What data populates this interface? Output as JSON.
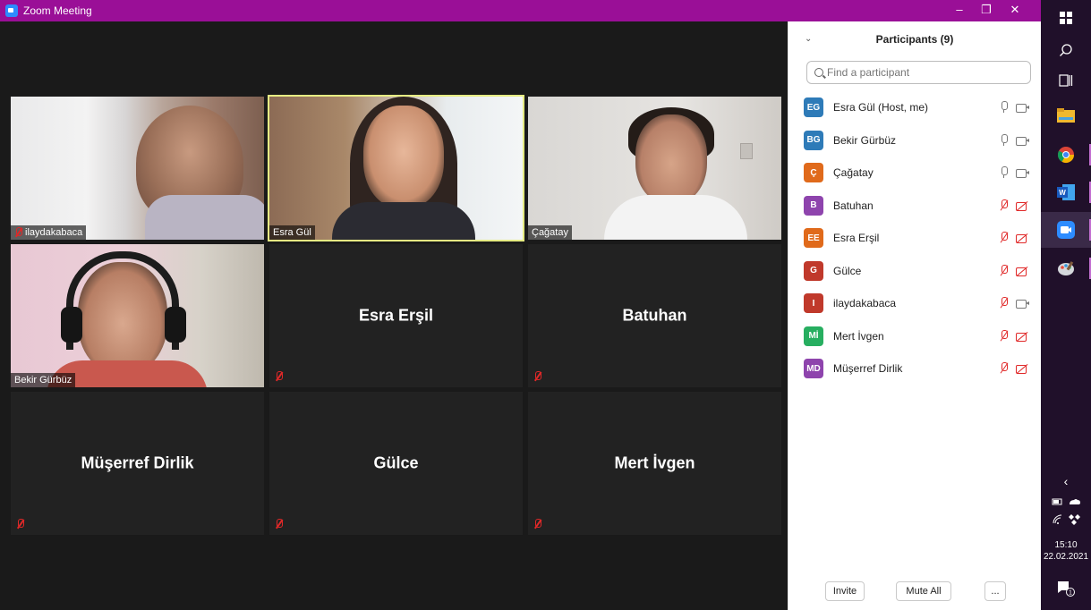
{
  "window": {
    "title": "Zoom Meeting",
    "minimize": "–",
    "restore": "❐",
    "close": "✕",
    "title_bar_color": "#9a0f97"
  },
  "video_tiles": [
    {
      "name": "ilaydakabaca",
      "video": true,
      "muted": true
    },
    {
      "name": "Esra Gül",
      "video": true,
      "muted": false,
      "active_speaker": true
    },
    {
      "name": "Çağatay",
      "video": true,
      "muted": false
    },
    {
      "name": "Bekir Gürbüz",
      "video": true,
      "muted": false
    },
    {
      "name": "Esra Erşil",
      "video": false,
      "muted": true
    },
    {
      "name": "Batuhan",
      "video": false,
      "muted": true
    },
    {
      "name": "Müşerref Dirlik",
      "video": false,
      "muted": true
    },
    {
      "name": "Gülce",
      "video": false,
      "muted": true
    },
    {
      "name": "Mert İvgen",
      "video": false,
      "muted": true
    }
  ],
  "participants_panel": {
    "title": "Participants (9)",
    "search_placeholder": "Find a participant",
    "participants": [
      {
        "initials": "EG",
        "name": "Esra Gül (Host, me)",
        "color": "#2e7bb8",
        "mic": "on",
        "cam": "on"
      },
      {
        "initials": "BG",
        "name": "Bekir Gürbüz",
        "color": "#2e7bb8",
        "mic": "on",
        "cam": "on"
      },
      {
        "initials": "Ç",
        "name": "Çağatay",
        "color": "#e06a1b",
        "mic": "on",
        "cam": "on"
      },
      {
        "initials": "B",
        "name": "Batuhan",
        "color": "#8e44ad",
        "mic": "off",
        "cam": "off"
      },
      {
        "initials": "EE",
        "name": "Esra Erşil",
        "color": "#e06a1b",
        "mic": "off",
        "cam": "off"
      },
      {
        "initials": "G",
        "name": "Gülce",
        "color": "#c0392b",
        "mic": "off",
        "cam": "off"
      },
      {
        "initials": "I",
        "name": "ilaydakabaca",
        "color": "#c0392b",
        "mic": "off",
        "cam": "on"
      },
      {
        "initials": "Mİ",
        "name": "Mert İvgen",
        "color": "#27ae60",
        "mic": "off",
        "cam": "off"
      },
      {
        "initials": "MD",
        "name": "Müşerref Dirlik",
        "color": "#8e44ad",
        "mic": "off",
        "cam": "off"
      }
    ],
    "footer": {
      "invite": "Invite",
      "mute_all": "Mute All",
      "more": "..."
    }
  },
  "taskbar": {
    "apps": [
      "windows-start-icon",
      "search-icon",
      "task-view-icon",
      "file-explorer-icon",
      "chrome-icon",
      "word-icon",
      "zoom-icon",
      "paint-icon"
    ],
    "chevron": "‹",
    "time": "15:10",
    "date": "22.02.2021",
    "notification_count": "1"
  }
}
